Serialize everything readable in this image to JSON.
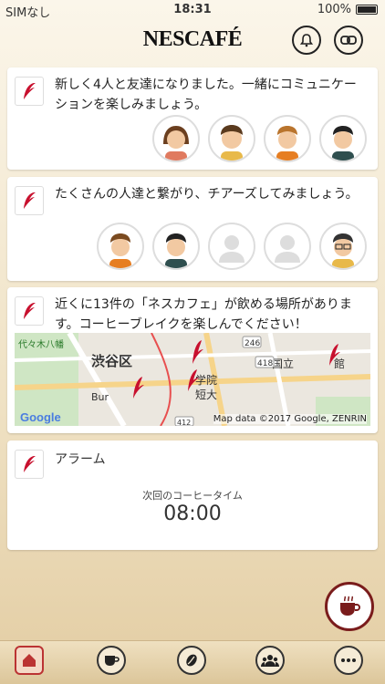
{
  "status": {
    "carrier": "SIMなし",
    "time": "18:31",
    "battery": "100%"
  },
  "header": {
    "logo": "NESCAFÉ"
  },
  "cards": {
    "friends": {
      "message": "新しく4人と友達になりました。一緒にコミュニケーションを楽しみましょう。"
    },
    "connect": {
      "message": "たくさんの人達と繋がり、チアーズしてみましょう。"
    },
    "places": {
      "message": "近くに13件の「ネスカフェ」が飲める場所があります。コーヒーブレイクを楽しんでください！",
      "map": {
        "labels": [
          "渋谷区",
          "代々木八幡",
          "国立",
          "館",
          "学院",
          "短大",
          "418",
          "246",
          "412",
          "Bur"
        ],
        "copyright": "Map data ©2017 Google, ZENRIN",
        "google": "Google"
      }
    },
    "alarm": {
      "title": "アラーム",
      "next_label": "次回のコーヒータイム",
      "time": "08:00"
    }
  },
  "icons": {
    "badge": "nescafe-swoosh-icon",
    "bell": "bell-icon",
    "link": "link-icon",
    "fab": "coffee-cup-icon"
  },
  "tabs": [
    "home-icon",
    "cup-icon",
    "bean-icon",
    "friends-icon",
    "more-icon"
  ],
  "colors": {
    "accent": "#c8102e",
    "fab_border": "#7a1c1c"
  }
}
